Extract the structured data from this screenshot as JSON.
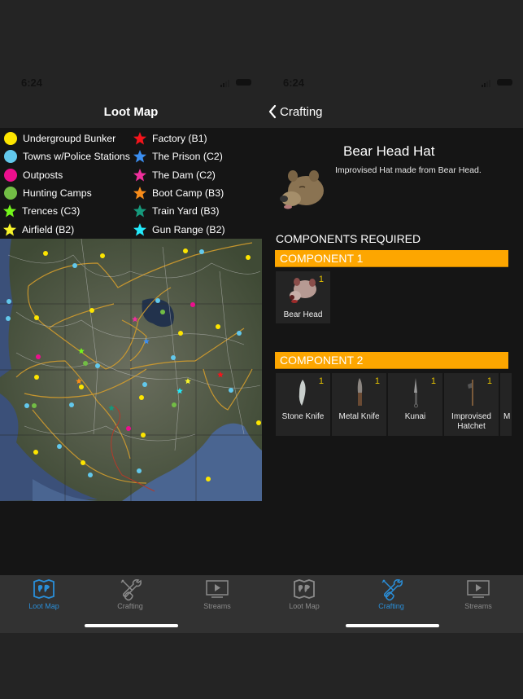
{
  "left_screen": {
    "status": {
      "time": "6:24"
    },
    "navbar": {
      "title": "Loot Map"
    },
    "legend": {
      "col1": [
        {
          "label": "Undergroupd Bunker",
          "shape": "circle",
          "color": "#fde500"
        },
        {
          "label": "Towns w/Police Stations",
          "shape": "circle",
          "color": "#62c8ec"
        },
        {
          "label": "Outposts",
          "shape": "circle",
          "color": "#ec0f8d"
        },
        {
          "label": "Hunting Camps",
          "shape": "circle",
          "color": "#72bd45"
        },
        {
          "label": "Trences (C3)",
          "shape": "star",
          "color": "#74f51b"
        },
        {
          "label": "Airfield (B2)",
          "shape": "star",
          "color": "#f8f52a"
        }
      ],
      "col2": [
        {
          "label": "Factory (B1)",
          "shape": "star",
          "color": "#f4141b"
        },
        {
          "label": "The Prison (C2)",
          "shape": "star",
          "color": "#3b8ef0"
        },
        {
          "label": "The Dam (C2)",
          "shape": "star",
          "color": "#f02f9c"
        },
        {
          "label": "Boot Camp (B3)",
          "shape": "star",
          "color": "#f78c1a"
        },
        {
          "label": "Train Yard (B3)",
          "shape": "star",
          "color": "#16997c"
        },
        {
          "label": "Gun Range (B2)",
          "shape": "star",
          "color": "#23eafb"
        }
      ]
    },
    "map": {
      "description": "Satellite loot map with markers"
    },
    "tabs": [
      {
        "label": "Loot Map",
        "icon": "map-icon",
        "active": true
      },
      {
        "label": "Crafting",
        "icon": "tools-icon",
        "active": false
      },
      {
        "label": "Streams",
        "icon": "tv-play-icon",
        "active": false
      }
    ]
  },
  "right_screen": {
    "status": {
      "time": "6:24"
    },
    "navbar": {
      "back_label": "Crafting"
    },
    "item": {
      "title": "Bear Head Hat",
      "description": "Improvised Hat made from Bear Head."
    },
    "components_heading": "COMPONENTS REQUIRED",
    "components": [
      {
        "label": "COMPONENT 1",
        "items": [
          {
            "name": "Bear Head",
            "qty": "1"
          }
        ]
      },
      {
        "label": "COMPONENT 2",
        "items": [
          {
            "name": "Stone Knife",
            "qty": "1"
          },
          {
            "name": "Metal Knife",
            "qty": "1"
          },
          {
            "name": "Kunai",
            "qty": "1"
          },
          {
            "name": "Improvised Hatchet",
            "qty": "1"
          },
          {
            "name": "M",
            "qty": ""
          }
        ]
      }
    ],
    "tabs": [
      {
        "label": "Loot Map",
        "icon": "map-icon",
        "active": false
      },
      {
        "label": "Crafting",
        "icon": "tools-icon",
        "active": true
      },
      {
        "label": "Streams",
        "icon": "tv-play-icon",
        "active": false
      }
    ]
  },
  "colors": {
    "accent_blue": "#2a8ed8",
    "component_bar": "#fda600",
    "quantity_text": "#e7c400"
  }
}
